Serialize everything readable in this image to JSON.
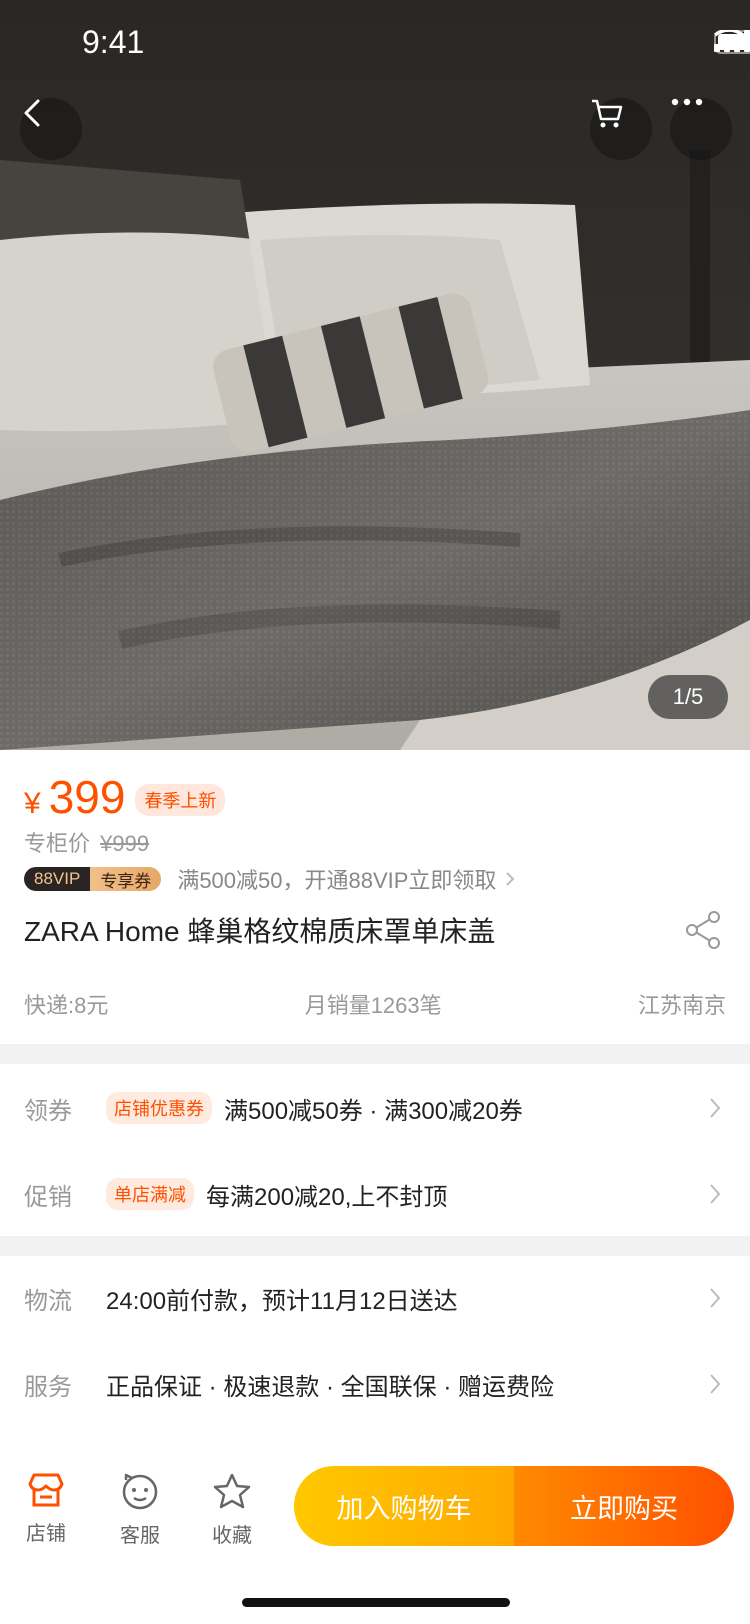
{
  "status": {
    "time": "9:41"
  },
  "gallery": {
    "counter": "1/5"
  },
  "price": {
    "symbol": "¥",
    "value": "399",
    "badge": "春季上新",
    "original_label": "专柜价",
    "original_value": "¥999"
  },
  "vip": {
    "badge_left": "88VIP",
    "badge_right": "专享券",
    "text": "满500减50，开通88VIP立即领取"
  },
  "product": {
    "title": "ZARA Home 蜂巢格纹棉质床罩单床盖"
  },
  "meta": {
    "shipping": "快递:8元",
    "sales": "月销量1263笔",
    "location": "江苏南京"
  },
  "coupon": {
    "label": "领券",
    "tag": "店铺优惠券",
    "text": "满500减50券 · 满300减20券"
  },
  "promo": {
    "label": "促销",
    "tag": "单店满减",
    "text": "每满200减20,上不封顶"
  },
  "logistics": {
    "label": "物流",
    "text": "24:00前付款，预计11月12日送达"
  },
  "service": {
    "label": "服务",
    "text": "正品保证 · 极速退款 · 全国联保 · 赠运费险"
  },
  "bottom_nav": {
    "shop": "店铺",
    "service": "客服",
    "favorite": "收藏"
  },
  "actions": {
    "add_to_cart": "加入购物车",
    "buy_now": "立即购买"
  },
  "colors": {
    "accent": "#ff5000",
    "cart_button": "#ffb400",
    "buy_button": "#ff6a00"
  },
  "icons": [
    "back-icon",
    "cart-icon",
    "more-icon",
    "share-icon",
    "shop-icon",
    "customer-service-icon",
    "star-icon",
    "chevron-right-icon"
  ]
}
